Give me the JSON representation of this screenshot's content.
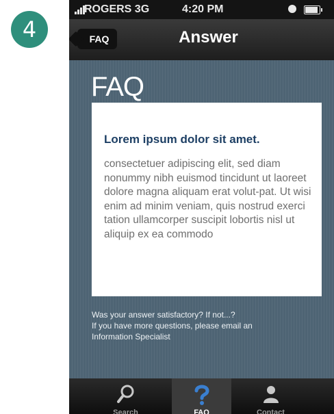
{
  "step_badge": "4",
  "status_bar": {
    "carrier": "ROGERS 3G",
    "time": "4:20 PM"
  },
  "nav_bar": {
    "back_label": "FAQ",
    "title": "Answer"
  },
  "content": {
    "heading": "FAQ",
    "answer_title": "Lorem ipsum dolor sit amet.",
    "answer_body": "consectetuer adipiscing elit, sed diam nonummy nibh euismod tincidunt ut laoreet dolore magna aliquam erat volut-pat. Ut wisi enim ad minim veniam, quis nostrud exerci tation ullamcorper suscipit lobortis nisl ut aliquip ex ea commodo",
    "footer_note": [
      "Was your answer satisfactory? If not...?",
      "If you have more questions, please email an",
      "Information Specialist"
    ]
  },
  "tab_bar": {
    "tabs": [
      {
        "label": "Search",
        "icon": "search-icon"
      },
      {
        "label": "FAQ",
        "icon": "question-icon"
      },
      {
        "label": "Contact",
        "icon": "person-icon"
      }
    ],
    "active": "FAQ"
  },
  "colors": {
    "badge": "#2f8f7c",
    "background": "#4e6474",
    "answer_title": "#1d3f64",
    "tab_active_icon": "#3a7fd0"
  }
}
